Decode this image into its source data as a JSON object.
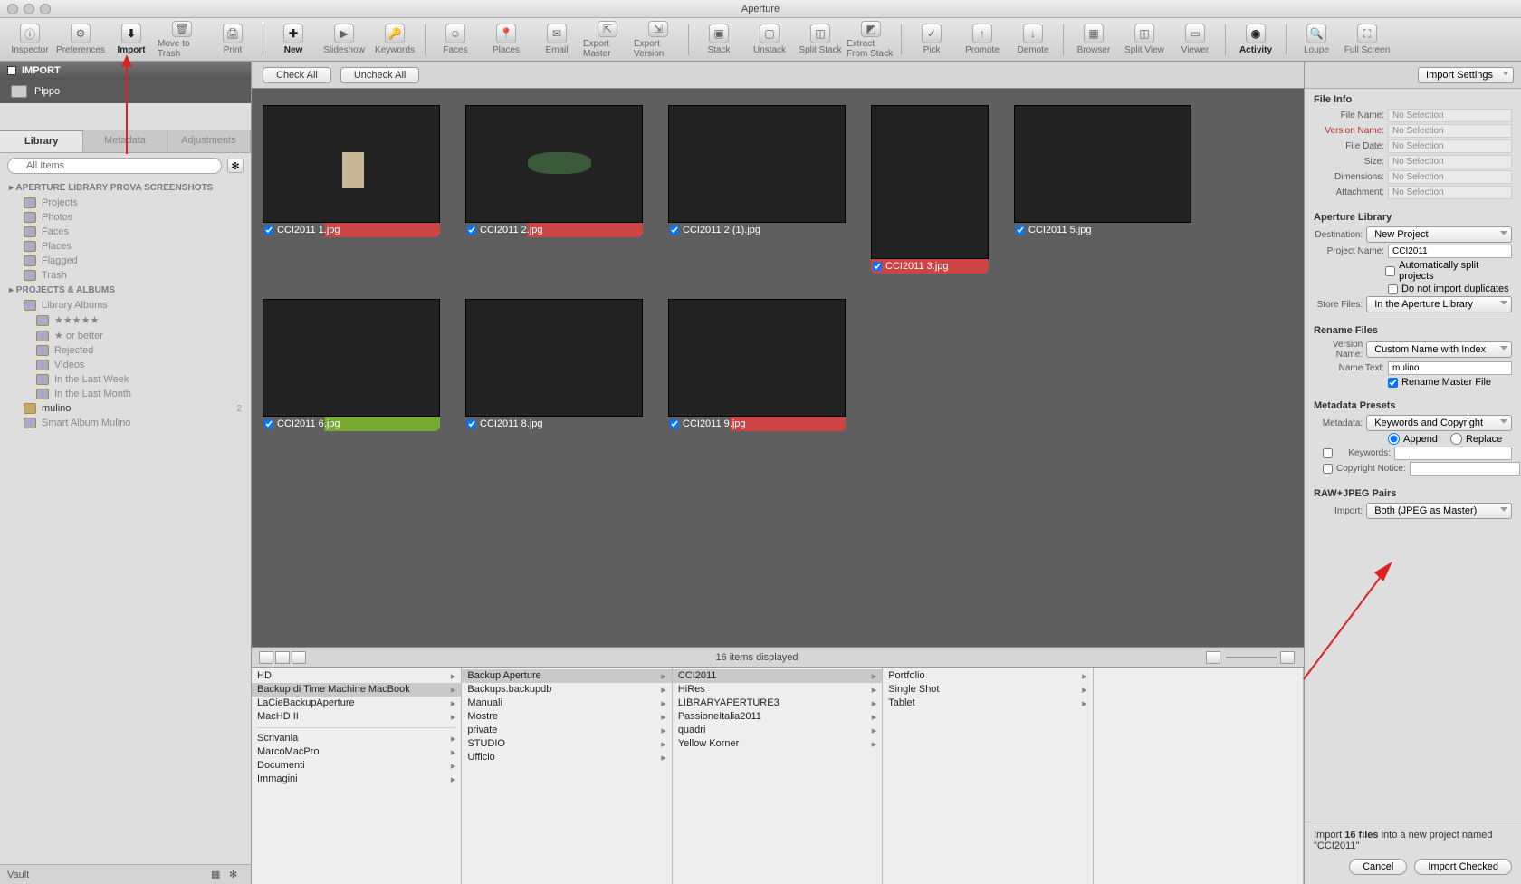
{
  "app_title": "Aperture",
  "toolbar": [
    {
      "label": "Inspector",
      "icon": "ⓘ"
    },
    {
      "label": "Preferences",
      "icon": "⚙"
    },
    {
      "label": "Import",
      "icon": "⬇",
      "on": true
    },
    {
      "label": "Move to Trash",
      "icon": "🗑"
    },
    {
      "label": "Print",
      "icon": "🖨"
    },
    {
      "sep": true
    },
    {
      "label": "New",
      "icon": "✚",
      "on": true
    },
    {
      "label": "Slideshow",
      "icon": "▶"
    },
    {
      "label": "Keywords",
      "icon": "🔑"
    },
    {
      "sep": true
    },
    {
      "label": "Faces",
      "icon": "☺"
    },
    {
      "label": "Places",
      "icon": "📍"
    },
    {
      "label": "Email",
      "icon": "✉"
    },
    {
      "label": "Export Master",
      "icon": "⇱"
    },
    {
      "label": "Export Version",
      "icon": "⇲"
    },
    {
      "sep": true
    },
    {
      "label": "Stack",
      "icon": "▣"
    },
    {
      "label": "Unstack",
      "icon": "▢"
    },
    {
      "label": "Split Stack",
      "icon": "◫"
    },
    {
      "label": "Extract From Stack",
      "icon": "◩"
    },
    {
      "sep": true
    },
    {
      "label": "Pick",
      "icon": "✓"
    },
    {
      "label": "Promote",
      "icon": "↑"
    },
    {
      "label": "Demote",
      "icon": "↓"
    },
    {
      "sep": true
    },
    {
      "label": "Browser",
      "icon": "▦"
    },
    {
      "label": "Split View",
      "icon": "◫"
    },
    {
      "label": "Viewer",
      "icon": "▭"
    },
    {
      "sep": true
    },
    {
      "label": "Activity",
      "icon": "◉",
      "on": true
    },
    {
      "sep": true
    },
    {
      "label": "Loupe",
      "icon": "🔍"
    },
    {
      "label": "Full Screen",
      "icon": "⛶"
    }
  ],
  "sidebar": {
    "import_label": "IMPORT",
    "device": "Pippo",
    "tabs": [
      "Library",
      "Metadata",
      "Adjustments"
    ],
    "search_placeholder": "All Items",
    "lib_header": "APERTURE LIBRARY PROVA SCREENSHOTS",
    "lib_items": [
      "Projects",
      "Photos",
      "Faces",
      "Places",
      "Flagged",
      "Trash"
    ],
    "proj_header": "PROJECTS & ALBUMS",
    "proj_root": "Library Albums",
    "proj_items": [
      "★★★★★",
      "★ or better",
      "Rejected",
      "Videos",
      "In the Last Week",
      "In the Last Month"
    ],
    "mulino": "mulino",
    "mulino_count": "2",
    "smart": "Smart Album Mulino",
    "vault": "Vault"
  },
  "topbar": {
    "check_all": "Check All",
    "uncheck_all": "Uncheck All"
  },
  "grid_status": "16 items displayed",
  "thumbs": [
    {
      "name": "CCI2011 1.jpg",
      "cap": "red",
      "cls": "sky",
      "extra": "mill"
    },
    {
      "name": "CCI2011 2.jpg",
      "cap": "red",
      "cls": "sea",
      "extra": "isle"
    },
    {
      "name": "CCI2011 2 (1).jpg",
      "cap": "dark",
      "cls": "moon"
    },
    {
      "name": "CCI2011 3.jpg",
      "cap": "redfull",
      "cls": "pink",
      "tall": true
    },
    {
      "name": "CCI2011 5.jpg",
      "cap": "dark",
      "cls": "sunset"
    },
    {
      "name": "CCI2011 6.jpg",
      "cap": "green",
      "cls": "sunset2"
    },
    {
      "name": "CCI2011 8.jpg",
      "cap": "dark",
      "cls": "rose"
    },
    {
      "name": "CCI2011 9.jpg",
      "cap": "red",
      "cls": "shadow"
    }
  ],
  "columns": [
    [
      {
        "t": "HD",
        "a": 1
      },
      {
        "t": "Backup di Time Machine MacBook",
        "a": 1,
        "sel": 1
      },
      {
        "t": "LaCieBackupAperture",
        "a": 1
      },
      {
        "t": "MacHD II",
        "a": 1
      },
      {
        "sep": 1
      },
      {
        "t": "Scrivania",
        "a": 1
      },
      {
        "t": "MarcoMacPro",
        "a": 1
      },
      {
        "t": "Documenti",
        "a": 1
      },
      {
        "t": "Immagini",
        "a": 1
      }
    ],
    [
      {
        "t": "Backup Aperture",
        "a": 1,
        "sel": 1
      },
      {
        "t": "Backups.backupdb",
        "a": 1
      },
      {
        "t": "Manuali",
        "a": 1
      },
      {
        "t": "Mostre",
        "a": 1
      },
      {
        "t": "private",
        "a": 1
      },
      {
        "t": "STUDIO",
        "a": 1
      },
      {
        "t": "Ufficio",
        "a": 1
      }
    ],
    [
      {
        "t": "CCI2011",
        "a": 1,
        "sel": 1
      },
      {
        "t": "HiRes",
        "a": 1
      },
      {
        "t": "LIBRARYAPERTURE3",
        "a": 1
      },
      {
        "t": "PassioneItalia2011",
        "a": 1
      },
      {
        "t": "quadri",
        "a": 1
      },
      {
        "t": "Yellow Korner",
        "a": 1
      }
    ],
    [
      {
        "t": "Portfolio",
        "a": 1
      },
      {
        "t": "Single Shot",
        "a": 1
      },
      {
        "t": "Tablet",
        "a": 1
      }
    ],
    []
  ],
  "rpanel": {
    "import_settings": "Import Settings",
    "file_info": {
      "title": "File Info",
      "rows": [
        {
          "l": "File Name:",
          "v": "No Selection"
        },
        {
          "l": "Version Name:",
          "v": "No Selection",
          "red": 1
        },
        {
          "l": "File Date:",
          "v": "No Selection"
        },
        {
          "l": "Size:",
          "v": "No Selection"
        },
        {
          "l": "Dimensions:",
          "v": "No Selection"
        },
        {
          "l": "Attachment:",
          "v": "No Selection"
        }
      ]
    },
    "lib": {
      "title": "Aperture Library",
      "dest_l": "Destination:",
      "dest_v": "New Project",
      "proj_l": "Project Name:",
      "proj_v": "CCI2011",
      "auto": "Automatically split projects",
      "dup": "Do not import duplicates",
      "store_l": "Store Files:",
      "store_v": "In the Aperture Library"
    },
    "rename": {
      "title": "Rename Files",
      "vn_l": "Version Name:",
      "vn_v": "Custom Name with Index",
      "nt_l": "Name Text:",
      "nt_v": "mulino",
      "master": "Rename Master File"
    },
    "meta": {
      "title": "Metadata Presets",
      "m_l": "Metadata:",
      "m_v": "Keywords and Copyright",
      "append": "Append",
      "replace": "Replace",
      "kw_l": "Keywords:",
      "cn_l": "Copyright Notice:"
    },
    "raw": {
      "title": "RAW+JPEG Pairs",
      "imp_l": "Import:",
      "imp_v": "Both (JPEG as Master)"
    },
    "foot": {
      "msg1": "Import ",
      "bold": "16 files",
      "msg2": " into a new project named \"",
      "proj": "CCI2011",
      "msg3": "\"",
      "cancel": "Cancel",
      "import": "Import Checked"
    }
  }
}
